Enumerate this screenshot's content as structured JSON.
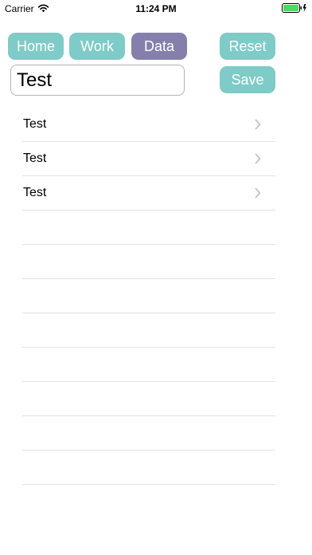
{
  "status_bar": {
    "carrier": "Carrier",
    "time": "11:24 PM",
    "wifi_icon": "wifi-icon",
    "battery_icon": "battery-charging-icon",
    "battery_color": "#4cd964"
  },
  "tabs": [
    {
      "label": "Home",
      "active": false
    },
    {
      "label": "Work",
      "active": false
    },
    {
      "label": "Data",
      "active": true
    }
  ],
  "actions": {
    "reset_label": "Reset",
    "save_label": "Save"
  },
  "input": {
    "value": "Test"
  },
  "list": {
    "items": [
      {
        "label": "Test",
        "icon": "chevron-right-icon"
      },
      {
        "label": "Test",
        "icon": "chevron-right-icon"
      },
      {
        "label": "Test",
        "icon": "chevron-right-icon"
      }
    ],
    "empty_rows": 8
  },
  "colors": {
    "button": "#7ecbc8",
    "button_active": "#8480ab",
    "button_text": "#ffffff",
    "separator": "#e3e3e6"
  }
}
